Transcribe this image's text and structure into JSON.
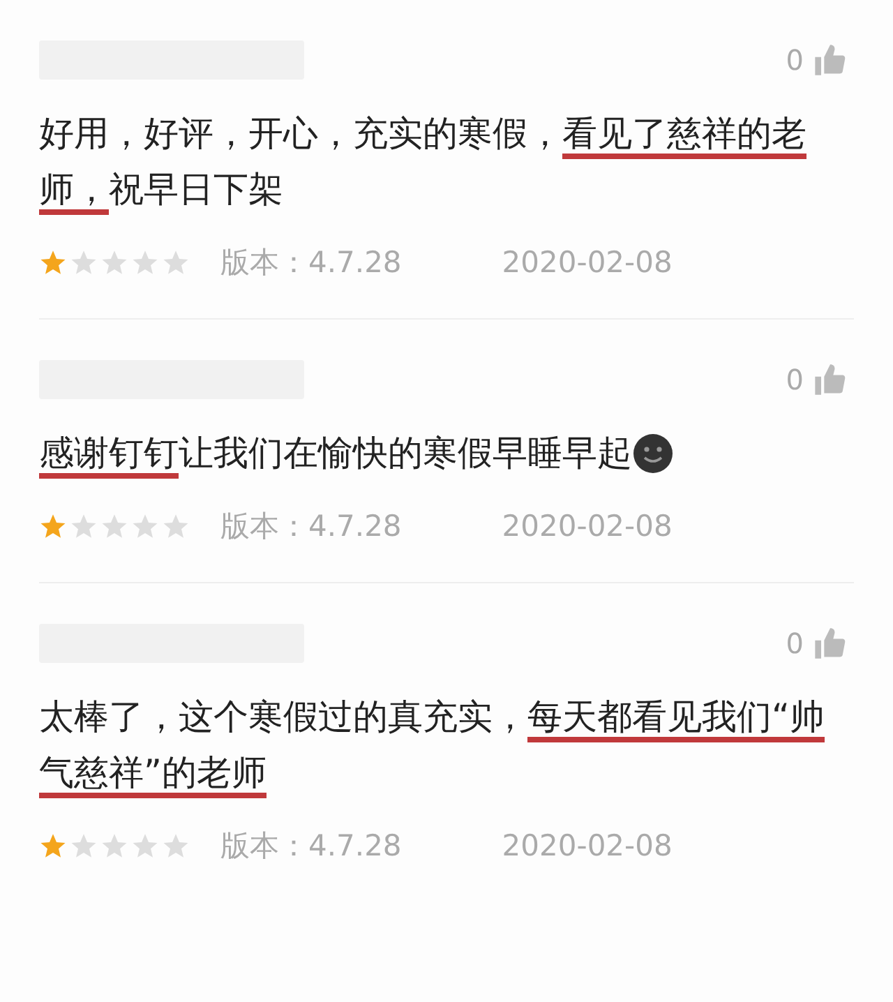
{
  "reviews": [
    {
      "likes": "0",
      "segments": [
        {
          "text": "好用，好评，开心，充实的寒假，",
          "underlined": false
        },
        {
          "text": "看见了慈祥的老师，",
          "underlined": true
        },
        {
          "text": "祝早日下架",
          "underlined": false
        }
      ],
      "emoji": false,
      "stars": 1,
      "version": "版本：4.7.28",
      "date": "2020-02-08"
    },
    {
      "likes": "0",
      "segments": [
        {
          "text": "感谢钉钉",
          "underlined": true
        },
        {
          "text": "让我们在愉快的寒假早睡早起",
          "underlined": false
        }
      ],
      "emoji": true,
      "stars": 1,
      "version": "版本：4.7.28",
      "date": "2020-02-08"
    },
    {
      "likes": "0",
      "segments": [
        {
          "text": "太棒了，这个寒假过的真充实，",
          "underlined": false
        },
        {
          "text": "每天都看见我们“帅气慈祥”的老师",
          "underlined": true
        }
      ],
      "emoji": false,
      "stars": 1,
      "version": "版本：4.7.28",
      "date": "2020-02-08"
    }
  ]
}
